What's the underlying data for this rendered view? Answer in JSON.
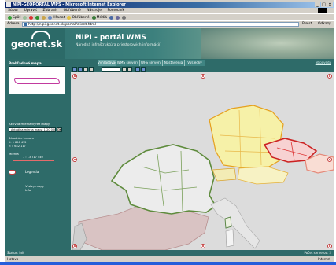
{
  "browser": {
    "title": "NIPI-GEOPORTAL WPS - Microsoft Internet Explorer",
    "menu": [
      "Súbor",
      "Upraviť",
      "Zobraziť",
      "Obľúbené",
      "Nástroje",
      "Pomocník"
    ],
    "toolbar": [
      "Späť",
      "Ďalej",
      "Hľadať",
      "Obľúbené",
      "Médiá"
    ],
    "address_label": "Adresa",
    "address": "http://nipi.geonet.sk/portal/client.html",
    "go_label": "Prejsť",
    "links_label": "Odkazy",
    "status_left": "Hotovo",
    "status_zone": "Internet"
  },
  "header": {
    "logo": "geonet.sk",
    "title": "NIPI - portál WMS",
    "subtitle": "Národná infraštruktúra priestorových informácií"
  },
  "left_panel": {
    "overview_title": "Prehľadová mapa",
    "scale_label": "Aktívna mierka/výrez mapy",
    "scale_value": "Aktuálna mierka mapy: 1:20 000",
    "scale_button": "OK",
    "coords_label": "Súradnice kurzora",
    "coords_lines": [
      "X: 1 856 412",
      "Y: 5 642 117"
    ],
    "scalebar_label": "Mierka",
    "scalebar_text": "1 : 13 717 440",
    "legend_label": "Legenda",
    "layers": [
      "Vrstvy mapy",
      "Info"
    ]
  },
  "tabs": [
    "Vyhľadávač",
    "WMS servery",
    "WFS servery",
    "Nastavenia",
    "Výsledky"
  ],
  "tab_right": "Nápoveda",
  "page_status": {
    "left": "Status: Init",
    "right": "Počet serverov: 2"
  },
  "colors": {
    "teal": "#2e6b69",
    "france_fill": "#e8e8e8",
    "france_border": "#5e8b3c",
    "germany_fill": "#f5f0a5",
    "germany_border": "#e6a01d",
    "czech_border": "#cc2222",
    "slovakia_border": "#e58a7a",
    "spain_fill": "#d8bfbf",
    "austria_fill": "#f7f2c4"
  }
}
